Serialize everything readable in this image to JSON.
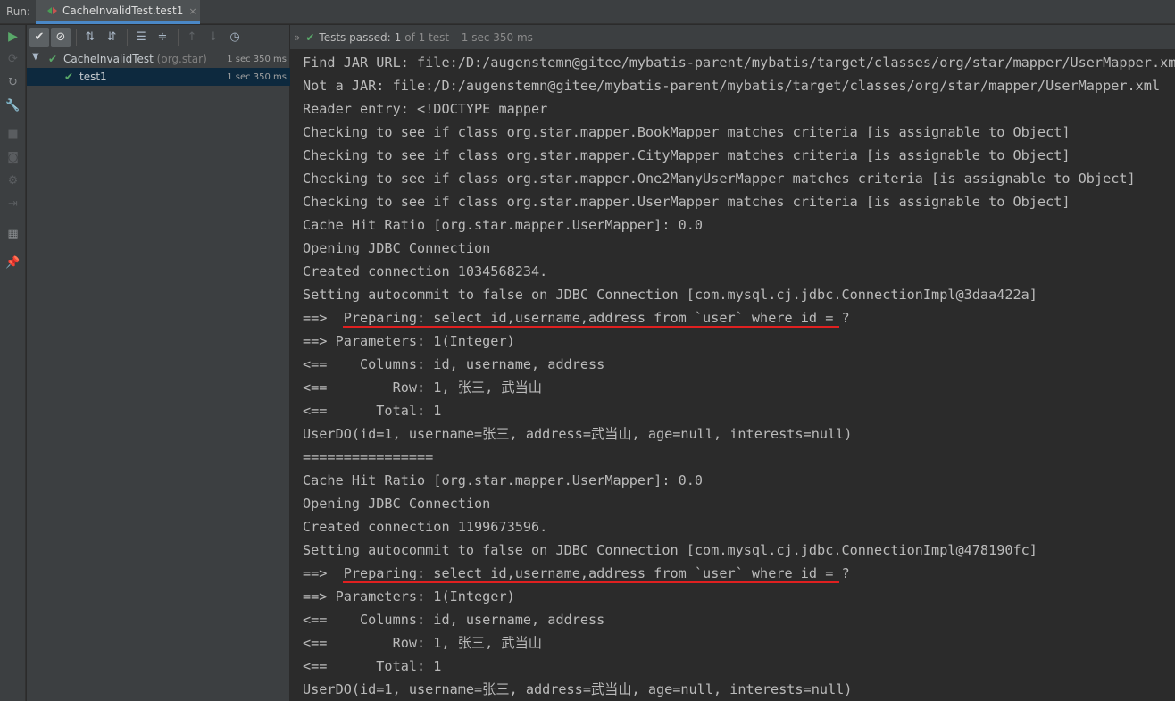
{
  "window": {
    "run_label": "Run:",
    "tab_title": "CacheInvalidTest.test1",
    "tab_close": "×"
  },
  "tree_toolbar": {
    "buttons": [
      "show-passed",
      "show-ignored",
      "sort-alpha",
      "sort-duration",
      "expand-all",
      "collapse-all",
      "prev-failed",
      "next-failed",
      "test-history",
      "more"
    ]
  },
  "status": {
    "passed_label": "Tests passed:",
    "passed_count": "1",
    "detail": "of 1 test – 1 sec 350 ms"
  },
  "tree": {
    "suite": {
      "name": "CacheInvalidTest",
      "package": "(org.star)",
      "duration": "1 sec 350 ms"
    },
    "test": {
      "name": "test1",
      "duration": "1 sec 350 ms"
    }
  },
  "console": {
    "lines": [
      "Find JAR URL: file:/D:/augenstemn@gitee/mybatis-parent/mybatis/target/classes/org/star/mapper/UserMapper.xml",
      "Not a JAR: file:/D:/augenstemn@gitee/mybatis-parent/mybatis/target/classes/org/star/mapper/UserMapper.xml",
      "Reader entry: <!DOCTYPE mapper",
      "Checking to see if class org.star.mapper.BookMapper matches criteria [is assignable to Object]",
      "Checking to see if class org.star.mapper.CityMapper matches criteria [is assignable to Object]",
      "Checking to see if class org.star.mapper.One2ManyUserMapper matches criteria [is assignable to Object]",
      "Checking to see if class org.star.mapper.UserMapper matches criteria [is assignable to Object]",
      "Cache Hit Ratio [org.star.mapper.UserMapper]: 0.0",
      "Opening JDBC Connection",
      "Created connection 1034568234.",
      "Setting autocommit to false on JDBC Connection [com.mysql.cj.jdbc.ConnectionImpl@3daa422a]",
      "==>  Preparing: select id,username,address from `user` where id = ?",
      "==> Parameters: 1(Integer)",
      "<==    Columns: id, username, address",
      "<==        Row: 1, 张三, 武当山",
      "<==      Total: 1",
      "UserDO(id=1, username=张三, address=武当山, age=null, interests=null)",
      "================",
      "Cache Hit Ratio [org.star.mapper.UserMapper]: 0.0",
      "Opening JDBC Connection",
      "Created connection 1199673596.",
      "Setting autocommit to false on JDBC Connection [com.mysql.cj.jdbc.ConnectionImpl@478190fc]",
      "==>  Preparing: select id,username,address from `user` where id = ?",
      "==> Parameters: 1(Integer)",
      "<==    Columns: id, username, address",
      "<==        Row: 1, 张三, 武当山",
      "<==      Total: 1",
      "UserDO(id=1, username=张三, address=武当山, age=null, interests=null)"
    ],
    "highlighted_lines": [
      11,
      22
    ]
  },
  "colors": {
    "accent_tab": "#4a88c7",
    "pass_green": "#59a869",
    "highlight_red": "#e02020",
    "console_bg": "#2b2b2b",
    "panel_bg": "#3c3f41"
  }
}
